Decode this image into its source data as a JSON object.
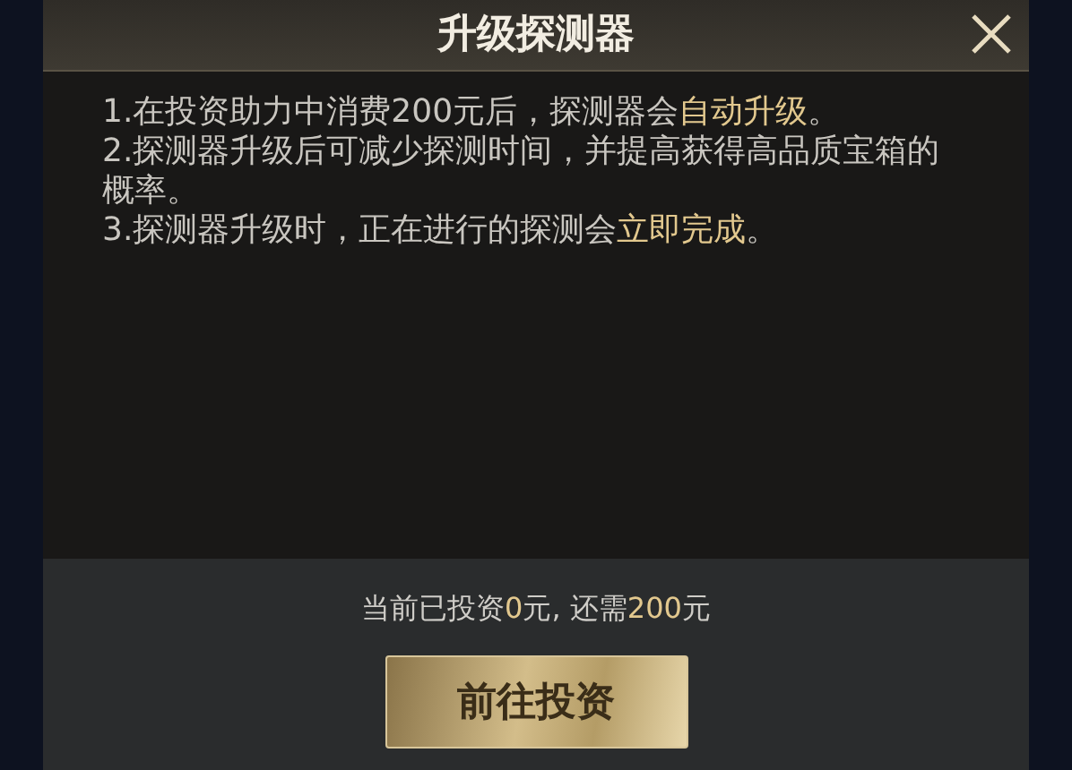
{
  "dialog": {
    "title": "升级探测器",
    "rules": [
      {
        "parts": [
          {
            "text": "1.在投资助力中消费200元后，探测器会",
            "highlight": false
          },
          {
            "text": "自动升级",
            "highlight": true
          },
          {
            "text": "。",
            "highlight": false
          }
        ]
      },
      {
        "parts": [
          {
            "text": "2.探测器升级后可减少探测时间，并提高获得高品质宝箱的概率。",
            "highlight": false
          }
        ]
      },
      {
        "parts": [
          {
            "text": "3.探测器升级时，正在进行的探测会",
            "highlight": false
          },
          {
            "text": "立即完成",
            "highlight": true
          },
          {
            "text": "。",
            "highlight": false
          }
        ]
      }
    ],
    "status": {
      "parts": [
        {
          "text": "当前已投资",
          "highlight": false
        },
        {
          "text": "0",
          "highlight": true
        },
        {
          "text": "元, 还需",
          "highlight": false
        },
        {
          "text": "200",
          "highlight": true
        },
        {
          "text": "元",
          "highlight": false
        }
      ]
    },
    "button": "前往投资"
  }
}
